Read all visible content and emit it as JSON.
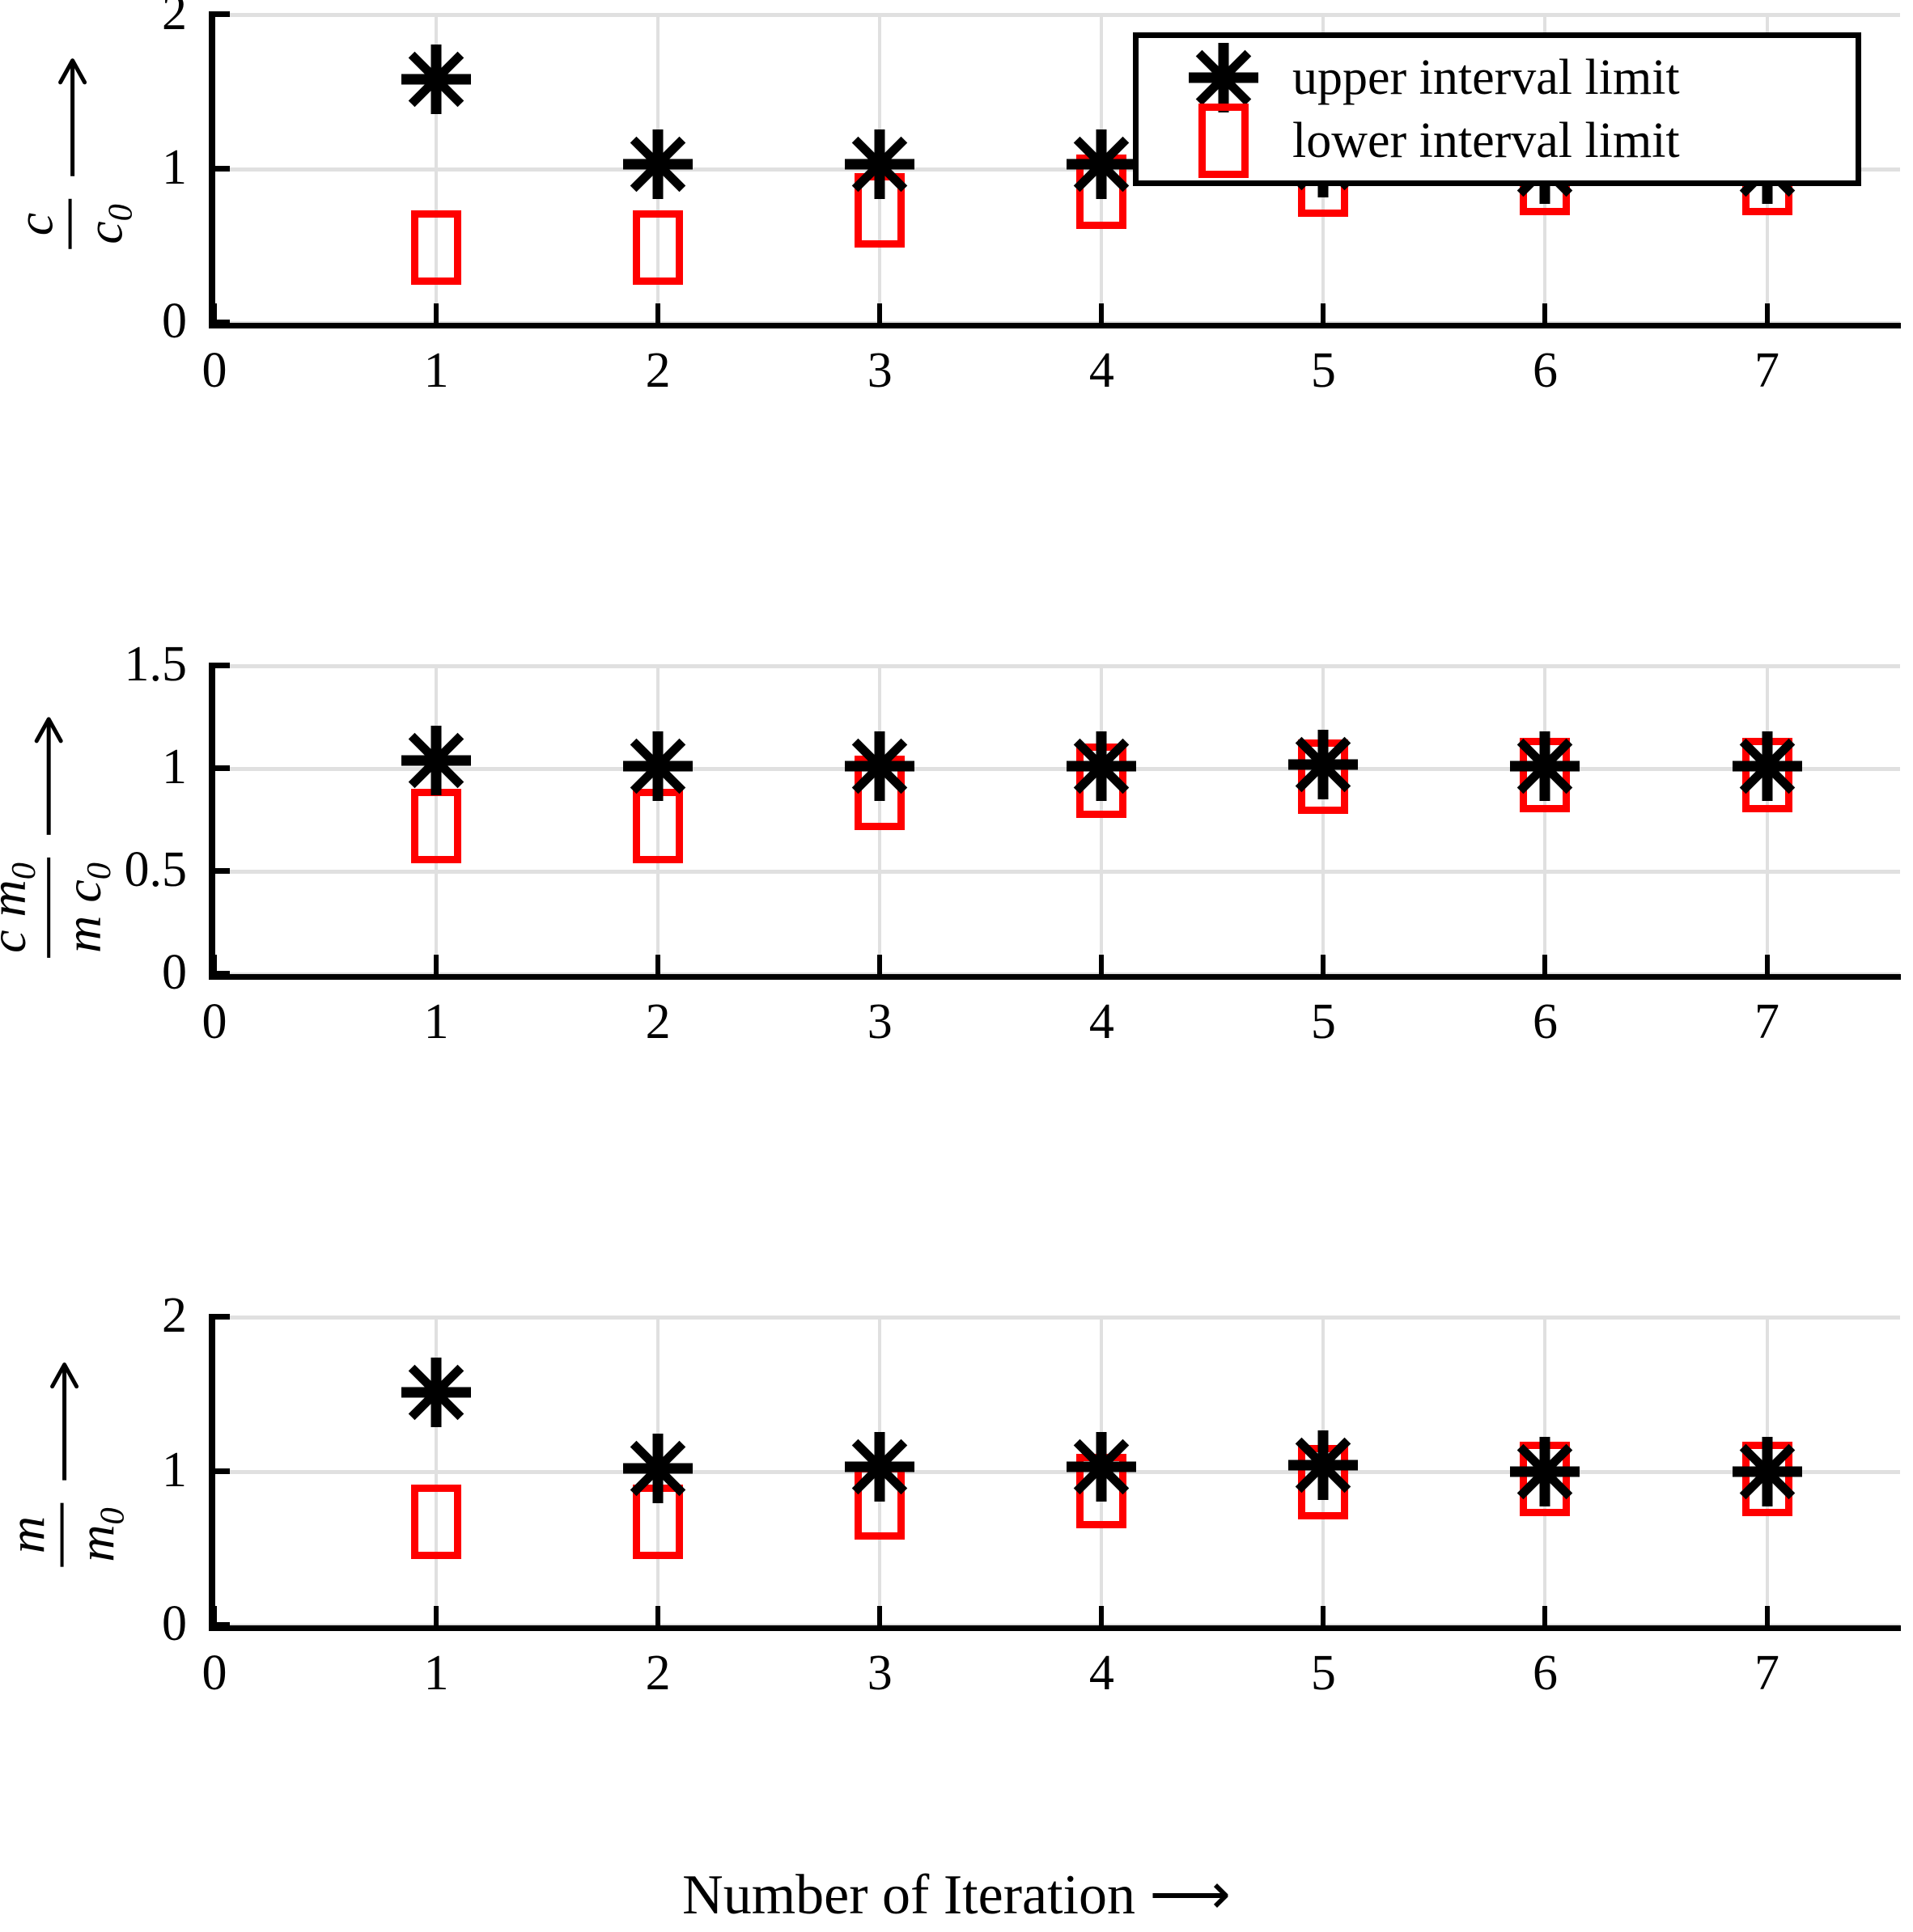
{
  "legend": {
    "entries": [
      {
        "label": "upper interval limit",
        "marker": "asterisk",
        "color": "#000000"
      },
      {
        "label": "lower interval limit",
        "marker": "square",
        "color": "#ff0000"
      }
    ]
  },
  "axes": {
    "x_title": "Number of Iteration ⟶",
    "x_ticks": [
      "0",
      "1",
      "2",
      "3",
      "4",
      "5",
      "6",
      "7"
    ]
  },
  "panels": [
    {
      "id": "panel-c-over-c0",
      "y_title_num": "c",
      "y_title_den": "c₀",
      "y_ticks": [
        "0",
        "1",
        "2"
      ]
    },
    {
      "id": "panel-cm0-over-mc0",
      "y_title_num": "c m₀",
      "y_title_den": "m c₀",
      "y_ticks": [
        "0",
        "0.5",
        "1",
        "1.5"
      ]
    },
    {
      "id": "panel-m-over-m0",
      "y_title_num": "m",
      "y_title_den": "m₀",
      "y_ticks": [
        "0",
        "1",
        "2"
      ]
    }
  ],
  "chart_data": [
    {
      "type": "scatter",
      "title": "",
      "xlabel": "Number of Iteration ⟶",
      "ylabel": "c / c0 ⟶",
      "x": [
        1,
        2,
        3,
        4,
        5,
        6,
        7
      ],
      "xlim": [
        0,
        7.6
      ],
      "ylim": [
        0,
        2
      ],
      "yticks": [
        0,
        1,
        2
      ],
      "grid": true,
      "series": [
        {
          "name": "upper interval limit",
          "marker": "asterisk",
          "color": "#000000",
          "values": [
            1.58,
            1.03,
            1.03,
            1.03,
            1.04,
            1.0,
            1.0
          ]
        },
        {
          "name": "lower interval limit",
          "marker": "square",
          "color": "#ff0000",
          "values": [
            0.49,
            0.49,
            0.73,
            0.85,
            0.93,
            0.94,
            0.94
          ]
        }
      ]
    },
    {
      "type": "scatter",
      "title": "",
      "xlabel": "Number of Iteration ⟶",
      "ylabel": "c m0 / (m c0) ⟶",
      "x": [
        1,
        2,
        3,
        4,
        5,
        6,
        7
      ],
      "xlim": [
        0,
        7.6
      ],
      "ylim": [
        0,
        1.5
      ],
      "yticks": [
        0,
        0.5,
        1,
        1.5
      ],
      "grid": true,
      "series": [
        {
          "name": "upper interval limit",
          "marker": "asterisk",
          "color": "#000000",
          "values": [
            1.04,
            1.01,
            1.01,
            1.01,
            1.02,
            1.01,
            1.01
          ]
        },
        {
          "name": "lower interval limit",
          "marker": "square",
          "color": "#ff0000",
          "values": [
            0.72,
            0.72,
            0.88,
            0.94,
            0.96,
            0.97,
            0.97
          ]
        }
      ]
    },
    {
      "type": "scatter",
      "title": "",
      "xlabel": "Number of Iteration ⟶",
      "ylabel": "m / m0 ⟶",
      "x": [
        1,
        2,
        3,
        4,
        5,
        6,
        7
      ],
      "xlim": [
        0,
        7.6
      ],
      "ylim": [
        0,
        2
      ],
      "yticks": [
        0,
        1,
        2
      ],
      "grid": true,
      "series": [
        {
          "name": "upper interval limit",
          "marker": "asterisk",
          "color": "#000000",
          "values": [
            1.51,
            1.02,
            1.03,
            1.03,
            1.04,
            1.0,
            1.0
          ]
        },
        {
          "name": "lower interval limit",
          "marker": "square",
          "color": "#ff0000",
          "values": [
            0.67,
            0.67,
            0.8,
            0.87,
            0.93,
            0.95,
            0.95
          ]
        }
      ]
    }
  ],
  "colors": {
    "upper": "#000000",
    "lower": "#ff0000",
    "grid": "#e0e0e0",
    "axis": "#000000"
  }
}
